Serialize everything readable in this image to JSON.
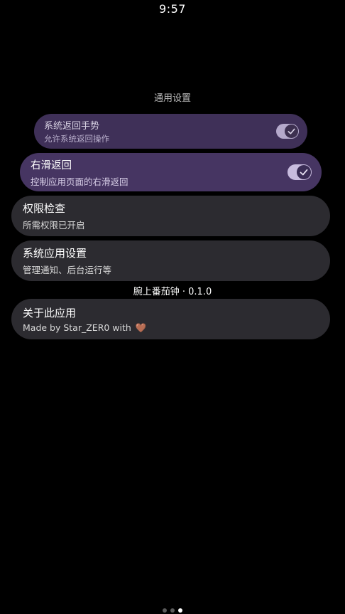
{
  "status_bar": {
    "time": "9:57"
  },
  "section": {
    "title": "通用设置"
  },
  "settings": {
    "back_gesture": {
      "title": "系统返回手势",
      "subtitle": "允许系统返回操作",
      "enabled": true
    },
    "swipe_back": {
      "title": "右滑返回",
      "subtitle": "控制应用页面的右滑返回",
      "enabled": true
    },
    "permissions": {
      "title": "权限检查",
      "subtitle": "所需权限已开启"
    },
    "system_app_settings": {
      "title": "系统应用设置",
      "subtitle": "管理通知、后台运行等"
    }
  },
  "version_label": "腕上番茄钟 · 0.1.0",
  "about": {
    "title": "关于此应用",
    "subtitle_prefix": "Made by Star_ZER0 with",
    "heart_glyph": "🤎"
  },
  "pager": {
    "total": 3,
    "current": 3
  },
  "colors": {
    "background": "#000000",
    "accent_purple": "#463562",
    "chip_gray": "#2c2b30"
  }
}
